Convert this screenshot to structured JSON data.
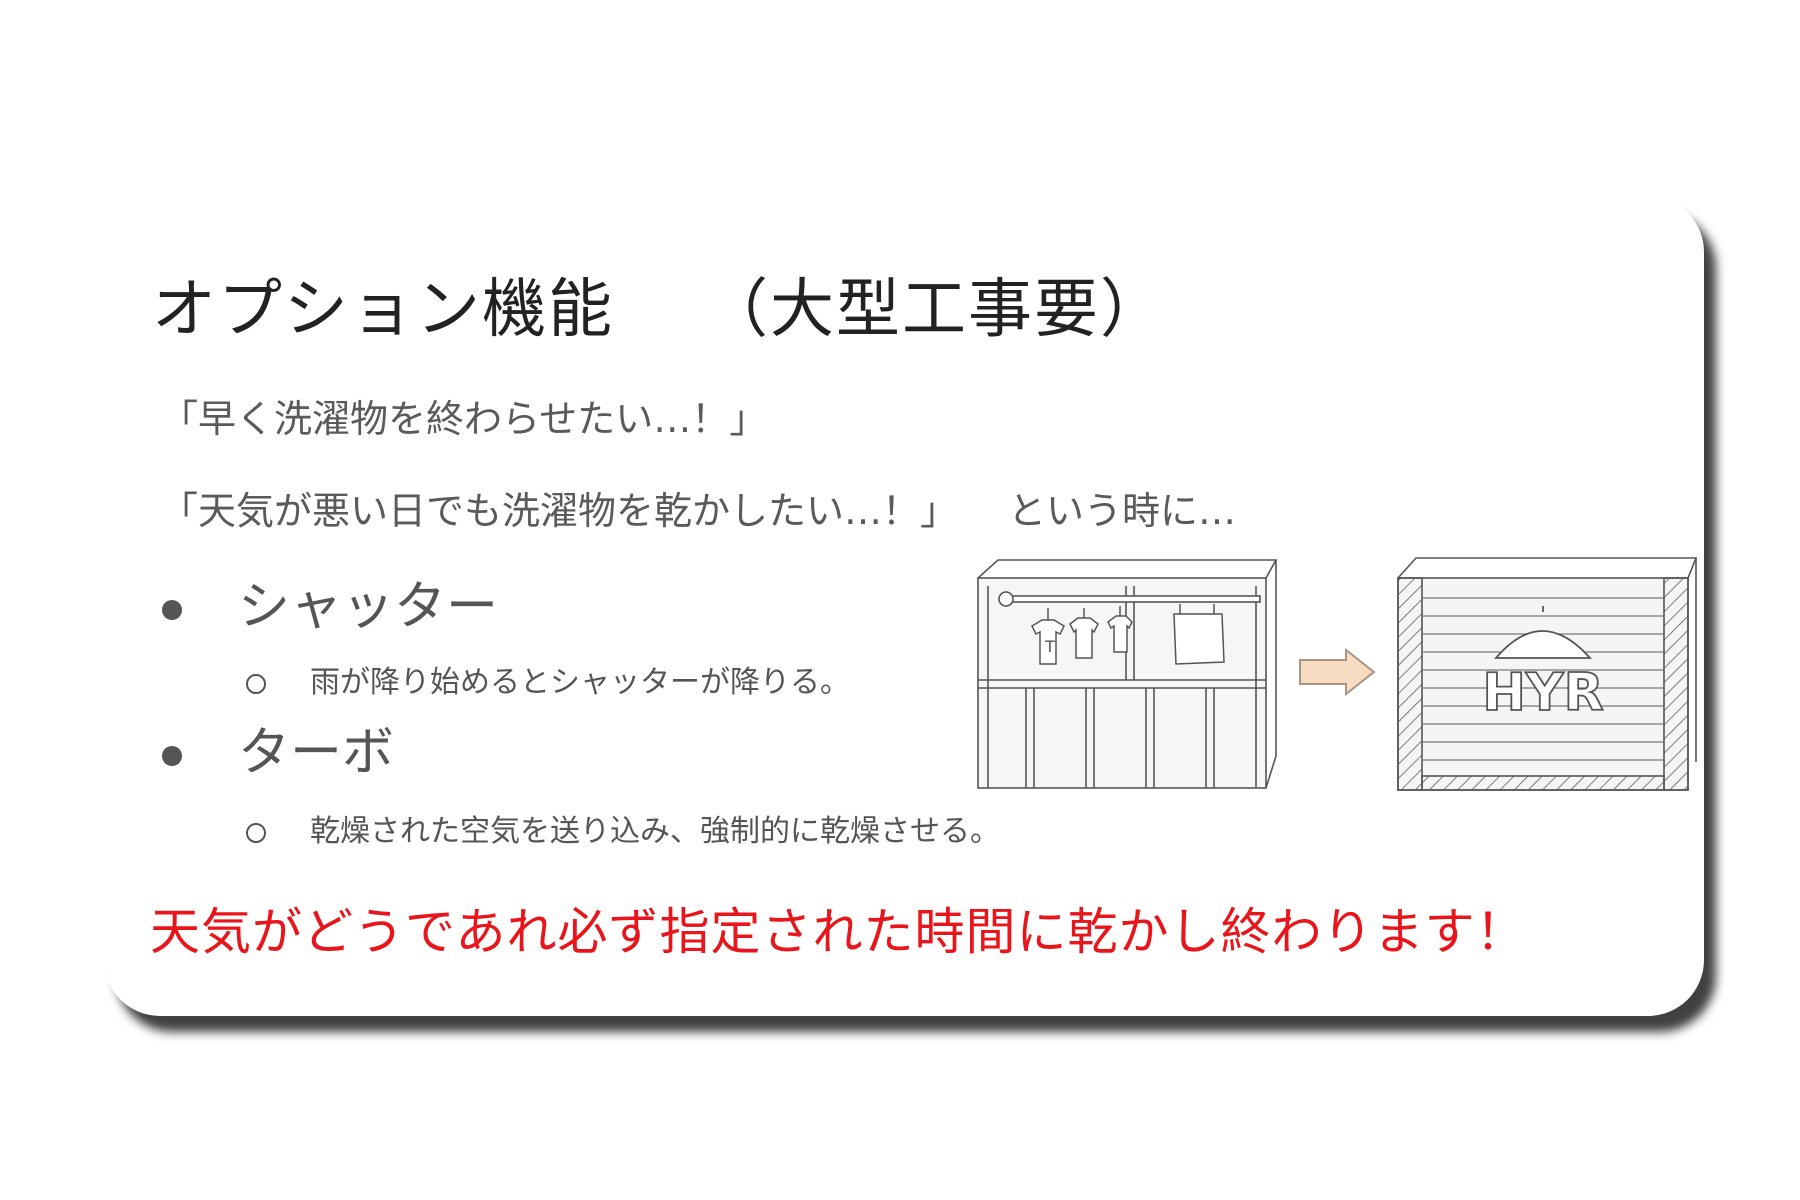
{
  "slide": {
    "title": "オプション機能",
    "title_note": "（大型工事要）",
    "line1": "「早く洗濯物を終わらせたい…！」",
    "line2_quote": "「天気が悪い日でも洗濯物を乾かしたい…！」",
    "line2_tail": "という時に…",
    "features": [
      {
        "label": "シャッター",
        "detail": "雨が降り始めるとシャッターが降りる。"
      },
      {
        "label": "ターボ",
        "detail": "乾燥された空気を送り込み、強制的に乾燥させる。"
      }
    ],
    "conclusion": "天気がどうであれ必ず指定された時間に乾かし終わります！",
    "illustration": {
      "shutter_logo_text": "HYR"
    }
  },
  "colors": {
    "conclusion": "#e8151b",
    "arrow_fill": "#f7dcc2",
    "arrow_stroke": "#a89482"
  }
}
